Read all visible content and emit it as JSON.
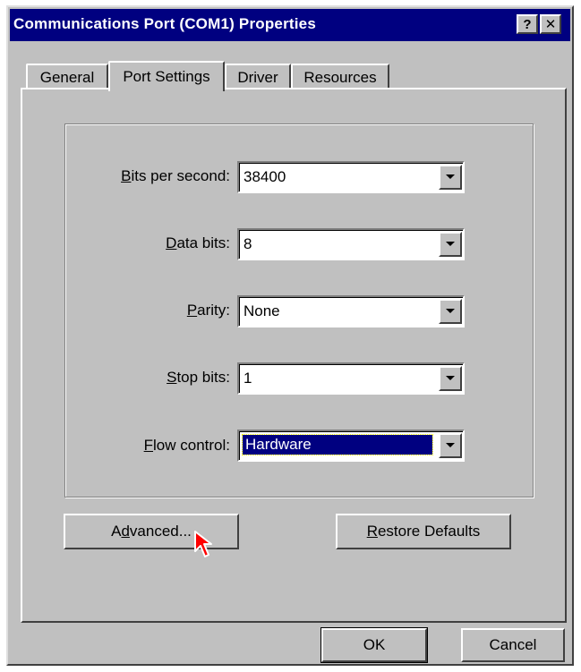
{
  "window": {
    "title": "Communications Port (COM1) Properties",
    "help_label": "?",
    "close_label": "✕"
  },
  "tabs": [
    {
      "label": "General",
      "active": false
    },
    {
      "label": "Port Settings",
      "active": true
    },
    {
      "label": "Driver",
      "active": false
    },
    {
      "label": "Resources",
      "active": false
    }
  ],
  "fields": [
    {
      "label_pre": "",
      "label_key": "B",
      "label_post": "its per second:",
      "value": "38400"
    },
    {
      "label_pre": "",
      "label_key": "D",
      "label_post": "ata bits:",
      "value": "8"
    },
    {
      "label_pre": "",
      "label_key": "P",
      "label_post": "arity:",
      "value": "None"
    },
    {
      "label_pre": "",
      "label_key": "S",
      "label_post": "top bits:",
      "value": "1"
    },
    {
      "label_pre": "",
      "label_key": "F",
      "label_post": "low control:",
      "value": "Hardware"
    }
  ],
  "buttons": {
    "advanced_pre": "A",
    "advanced_key": "d",
    "advanced_post": "vanced...",
    "restore_key": "R",
    "restore_post": "estore Defaults",
    "ok": "OK",
    "cancel": "Cancel"
  },
  "colors": {
    "title_bar": "#000080",
    "face": "#c0c0c0",
    "selection": "#000080",
    "cursor": "#ff0000"
  },
  "icons": [
    "help-icon",
    "close-icon",
    "dropdown-arrow-icon",
    "mouse-pointer-icon"
  ]
}
